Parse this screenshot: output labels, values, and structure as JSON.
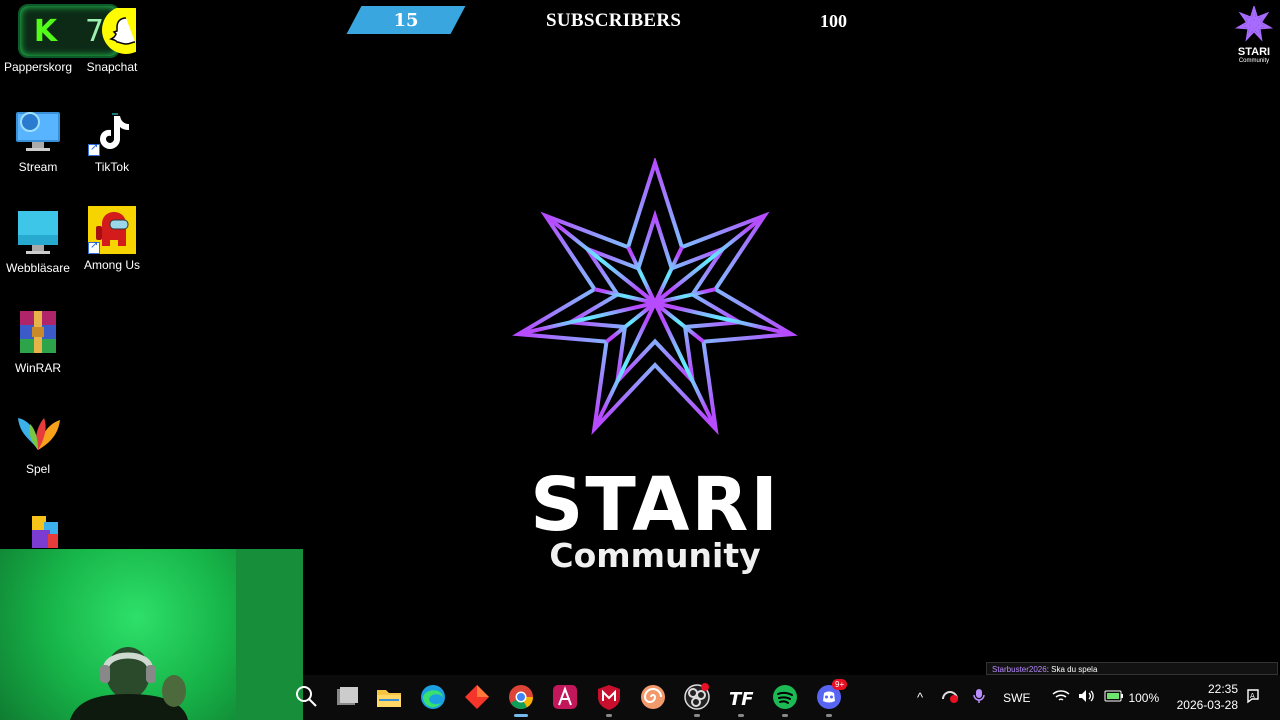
{
  "desktop": {
    "icons": [
      {
        "label": "Papperskorg"
      },
      {
        "label": "Snapchat"
      },
      {
        "label": "Stream"
      },
      {
        "label": "TikTok"
      },
      {
        "label": "Webbläsare"
      },
      {
        "label": "Among Us"
      },
      {
        "label": "WinRAR"
      },
      {
        "label": "Spel"
      }
    ]
  },
  "kick_badge": {
    "letter": "K",
    "count": "7"
  },
  "overlay": {
    "subscriber_count": "15",
    "subscribers_label": "SUBSCRIBERS",
    "subscriber_goal": "100"
  },
  "brand": {
    "title": "STARI",
    "subtitle": "Community",
    "mini_title": "STARI",
    "mini_subtitle": "Community"
  },
  "chat": {
    "user": "Starbuster2026",
    "message": ": Ska du spela"
  },
  "taskbar": {
    "apps": [
      "search-icon",
      "task-view-icon",
      "file-explorer-icon",
      "edge-icon",
      "red-diamond-app-icon",
      "chrome-icon",
      "affinity-icon",
      "mcafee-icon",
      "spiral-app-icon",
      "obs-icon",
      "tf-app-icon",
      "spotify-icon",
      "discord-icon"
    ],
    "discord_badge": "9+",
    "language": "SWE",
    "battery": "100%",
    "time": "22:35",
    "date": "2026-03-28"
  },
  "colors": {
    "accent_blue": "#3aa6e0",
    "kick_green": "#53fc18",
    "star_violet": "#b64bff",
    "star_cyan": "#5ff0ff"
  }
}
